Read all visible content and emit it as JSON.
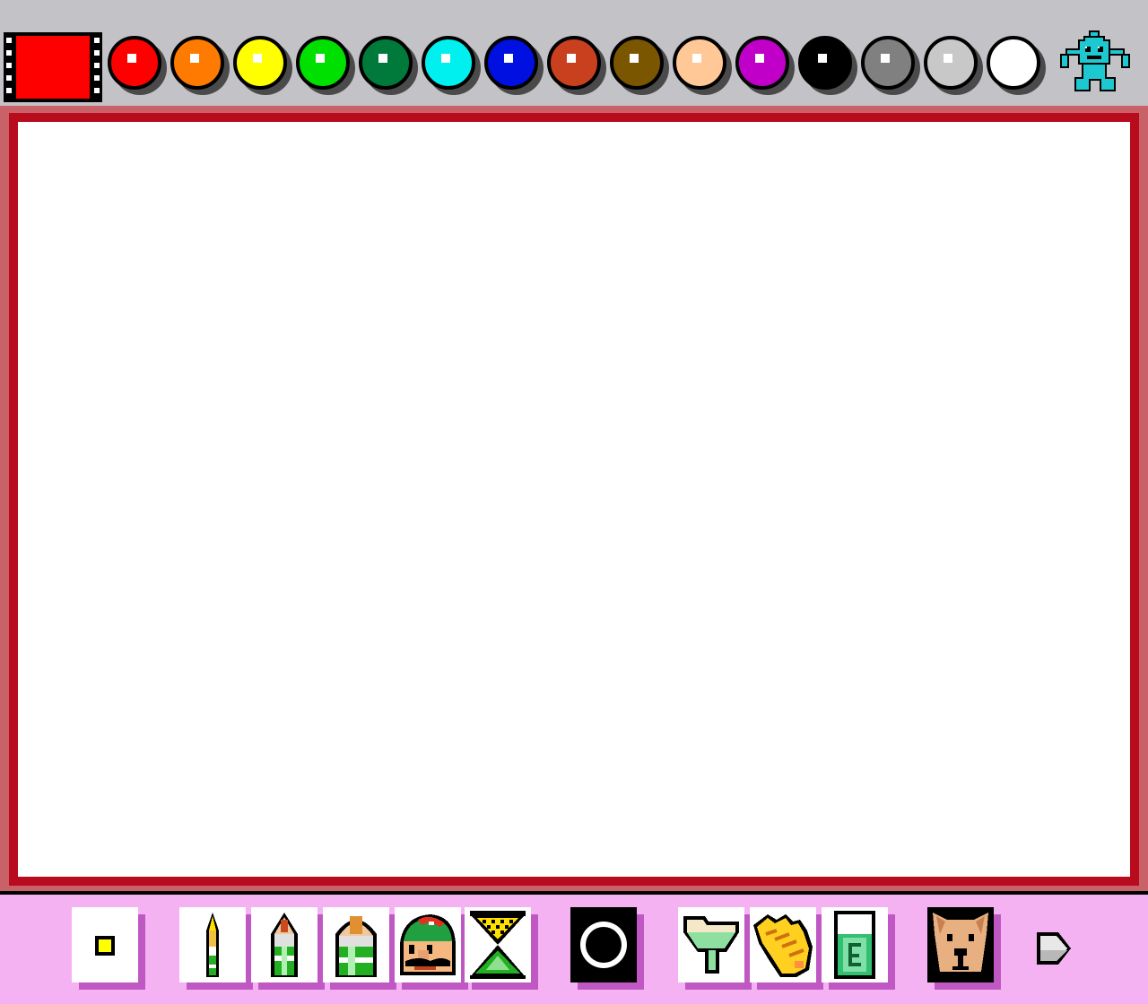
{
  "palette": {
    "current_color": "#ff0000",
    "colors": [
      {
        "name": "red",
        "hex": "#ff0000"
      },
      {
        "name": "orange",
        "hex": "#ff7a00"
      },
      {
        "name": "yellow",
        "hex": "#ffff00"
      },
      {
        "name": "green",
        "hex": "#00e000"
      },
      {
        "name": "dark-green",
        "hex": "#007a3a"
      },
      {
        "name": "cyan",
        "hex": "#00f0f0"
      },
      {
        "name": "blue",
        "hex": "#0010e0"
      },
      {
        "name": "brick",
        "hex": "#c8401e"
      },
      {
        "name": "brown",
        "hex": "#7a5600"
      },
      {
        "name": "peach",
        "hex": "#ffc896"
      },
      {
        "name": "purple",
        "hex": "#c000c8"
      },
      {
        "name": "black",
        "hex": "#000000"
      },
      {
        "name": "gray",
        "hex": "#808080"
      },
      {
        "name": "light-gray",
        "hex": "#c8c8c8"
      },
      {
        "name": "white",
        "hex": "#ffffff"
      }
    ],
    "mascot_icon": "robot-mascot-icon"
  },
  "canvas": {
    "background": "#ffffff",
    "border_color": "#b80c1e",
    "frame_color": "#c86268"
  },
  "toolbar": {
    "background": "#f4b2f2",
    "shadow_color": "#c058c4",
    "tools": [
      {
        "name": "brush-size-icon"
      },
      {
        "name": "thin-pencil-icon"
      },
      {
        "name": "medium-pencil-icon"
      },
      {
        "name": "thick-pencil-icon"
      },
      {
        "name": "mario-face-stamp-icon"
      },
      {
        "name": "hourglass-spray-icon"
      },
      {
        "name": "stamp-circle-icon"
      },
      {
        "name": "paint-bucket-icon"
      },
      {
        "name": "hand-pointer-icon"
      },
      {
        "name": "eraser-icon"
      },
      {
        "name": "dog-face-icon"
      },
      {
        "name": "next-arrow-icon"
      }
    ]
  }
}
